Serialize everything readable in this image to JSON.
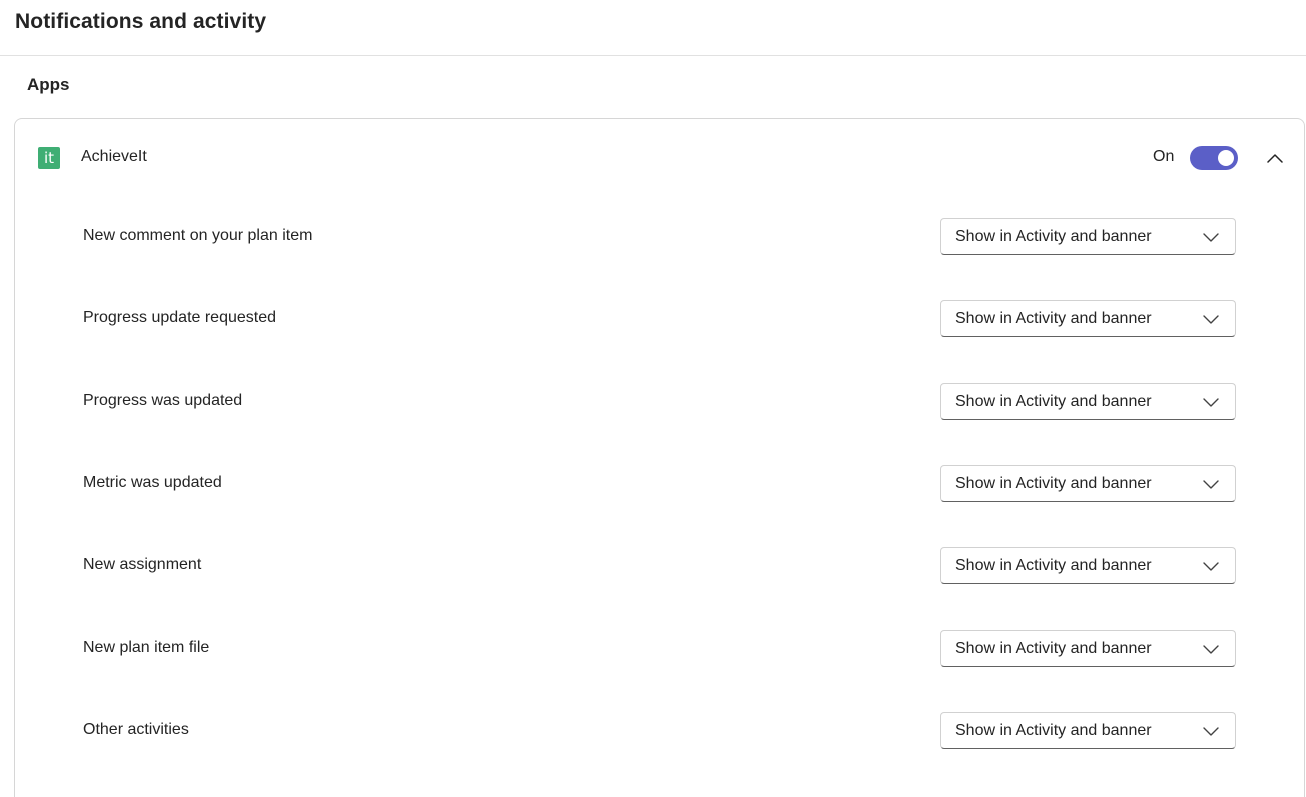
{
  "page": {
    "title": "Notifications and activity"
  },
  "apps_section": {
    "title": "Apps",
    "app": {
      "icon_text": "it",
      "icon_color": "#3fae74",
      "name": "AchieveIt",
      "toggle_label": "On",
      "toggle_on": true,
      "toggle_color": "#5b5fc7",
      "expanded": true,
      "settings": [
        {
          "label": "New comment on your plan item",
          "value": "Show in Activity and banner"
        },
        {
          "label": "Progress update requested",
          "value": "Show in Activity and banner"
        },
        {
          "label": "Progress was updated",
          "value": "Show in Activity and banner"
        },
        {
          "label": "Metric was updated",
          "value": "Show in Activity and banner"
        },
        {
          "label": "New assignment",
          "value": "Show in Activity and banner"
        },
        {
          "label": "New plan item file",
          "value": "Show in Activity and banner"
        },
        {
          "label": "Other activities",
          "value": "Show in Activity and banner"
        }
      ]
    }
  }
}
